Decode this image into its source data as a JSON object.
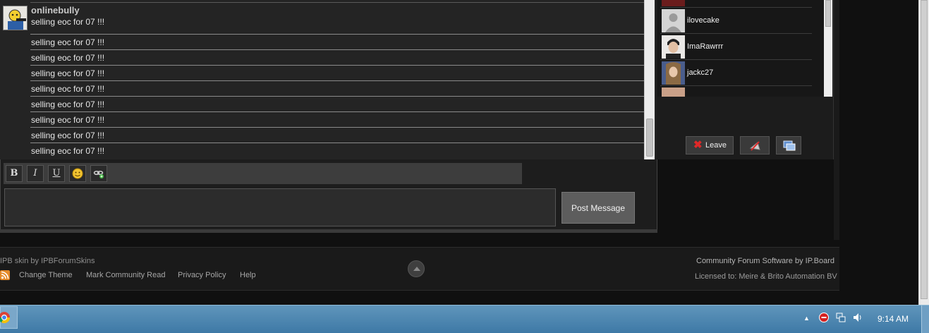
{
  "chat": {
    "poster_name": "onlinebully",
    "first_message": "selling eoc for 07 !!!",
    "messages": [
      "selling eoc for 07 !!!",
      "selling eoc for 07 !!!",
      "selling eoc for 07 !!!",
      "selling eoc for 07 !!!",
      "selling eoc for 07 !!!",
      "selling eoc for 07 !!!",
      "selling eoc for 07 !!!",
      "selling eoc for 07 !!!"
    ]
  },
  "toolbar": {
    "bold_label": "B",
    "italic_label": "I",
    "underline_label": "U"
  },
  "composer": {
    "post_label": "Post Message"
  },
  "users": {
    "items": [
      "ilovecake",
      "ImaRawrrr",
      "jackc27"
    ]
  },
  "panel_buttons": {
    "leave_label": "Leave"
  },
  "footer": {
    "skin_credit": "IPB skin by IPBForumSkins",
    "links": [
      "Change Theme",
      "Mark Community Read",
      "Privacy Policy",
      "Help"
    ],
    "software_credit": "Community Forum Software by IP.Board",
    "license": "Licensed to: Meire & Brito Automation BV"
  },
  "taskbar": {
    "clock": "9:14 AM"
  },
  "colors": {
    "accent_red": "#e02828",
    "taskbar_blue": "#4a82ae"
  }
}
